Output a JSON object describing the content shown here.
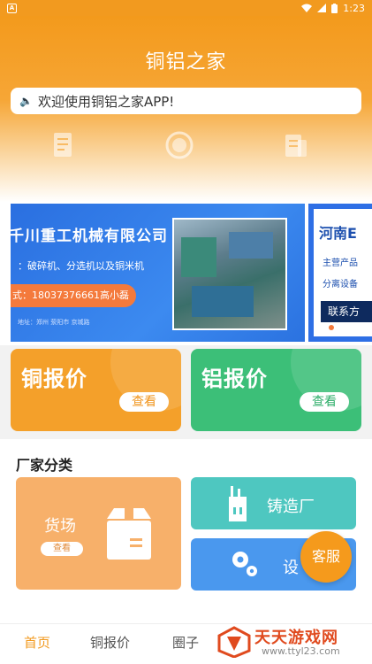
{
  "status_bar": {
    "time": "1:23",
    "app_icon": "A"
  },
  "header": {
    "title": "铜铝之家"
  },
  "notice": {
    "text": "欢迎使用铜铝之家APP!"
  },
  "banner": {
    "company": "千川重工机械有限公司",
    "products": "：破碎机、分选机以及铜米机",
    "contact": "式：18037376661高小磊",
    "address": "地址：郑州 荥阳市 京城路",
    "next_slide": {
      "heading": "河南E",
      "line1": "主营产品",
      "line2": "分离设备",
      "button": "联系方"
    },
    "active_dot": 0
  },
  "price_cards": [
    {
      "label": "铜报价",
      "view": "查看"
    },
    {
      "label": "铝报价",
      "view": "查看"
    }
  ],
  "category": {
    "title": "厂家分类",
    "yard": {
      "label": "货场",
      "view": "查看"
    },
    "foundry": {
      "label": "铸造厂"
    },
    "equipment": {
      "label": "设"
    }
  },
  "service_button": "客服",
  "tabs": [
    "首页",
    "铜报价",
    "圈子"
  ],
  "watermark": {
    "name": "天天游戏网",
    "url": "www.ttyl23.com"
  },
  "colors": {
    "brand_orange": "#f29a1f",
    "copper_card": "#f4a02a",
    "aluminum_card": "#3cbf78",
    "yard_card": "#f7b06a",
    "foundry_card": "#4ec7c0",
    "equipment_card": "#4a98ee"
  },
  "icons": {
    "quick_links": [
      "document-icon",
      "circle-icon",
      "news-icon"
    ],
    "yard": "box-icon",
    "foundry": "furnace-icon",
    "equipment": "gears-icon"
  }
}
